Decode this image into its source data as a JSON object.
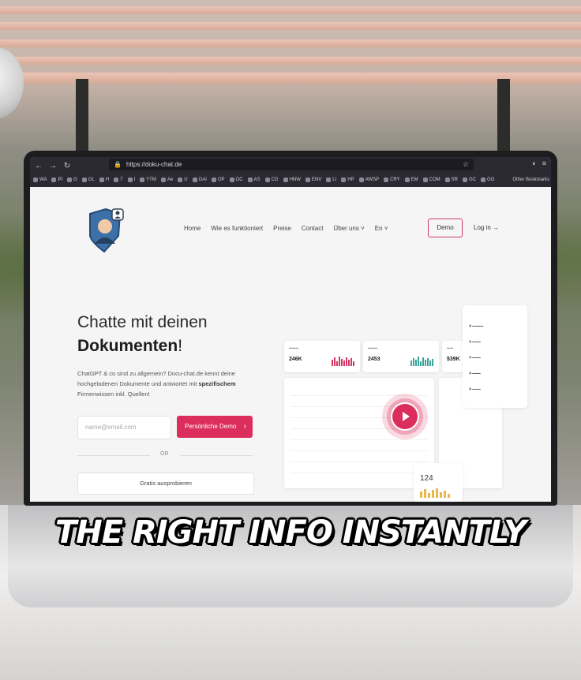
{
  "browser": {
    "url": "https://doku-chat.de",
    "bookmarks": [
      "WA",
      "PI",
      "G",
      "GL",
      "H",
      "7",
      "I",
      "YTM",
      "Ae",
      "U",
      "GAI",
      "OP",
      "OC",
      "AS",
      "CG",
      "HNW",
      "ENV",
      "LI",
      "HP",
      "AWSP",
      "CRY",
      "EM",
      "COM",
      "SR",
      "GC",
      "GO"
    ],
    "other_bookmarks": "Other Bookmarks"
  },
  "site": {
    "nav": [
      "Home",
      "Wie es funktioniert",
      "Preise",
      "Contact",
      "Über uns",
      "En"
    ],
    "demo_button": "Demo",
    "login": "Log in",
    "hero_line1": "Chatte mit deinen",
    "hero_line2_bold": "Dokumenten",
    "hero_line2_end": "!",
    "desc_part1": "ChatGPT & co sind zu allgemein? Docu-chat.de kennt deine hochgeladenen Dokumente und antwortet mit ",
    "desc_bold": "spezifischem",
    "desc_part2": " Firmenwissen inkl. Quellen!",
    "email_placeholder": "name@email.com",
    "cta_button": "Persönliche Demo",
    "or_label": "OR",
    "free_button": "Gratis ausprobieren"
  },
  "dashboard": {
    "kpis": [
      {
        "value": "246K"
      },
      {
        "value": "2453"
      },
      {
        "value": "$39K"
      }
    ],
    "visitor_value": "124"
  },
  "caption": "THE RIGHT INFO INSTANTLY",
  "colors": {
    "accent": "#dc2e5d",
    "chrome": "#2b2a33"
  }
}
